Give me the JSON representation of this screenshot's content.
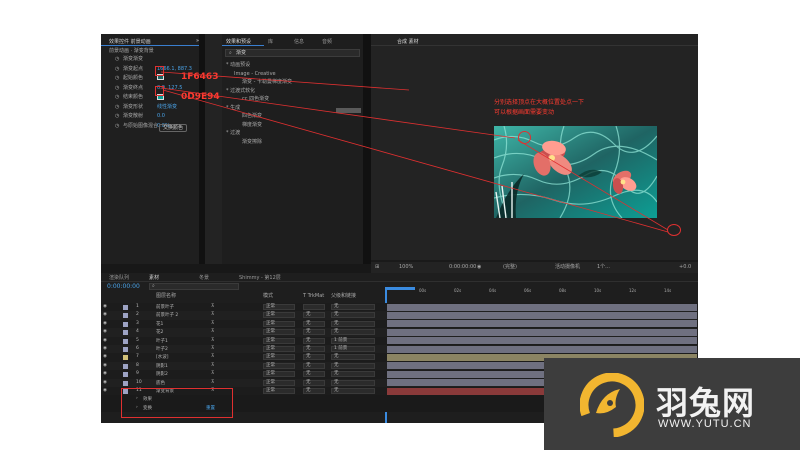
{
  "colors": {
    "accent": "#4aa3e8",
    "annotation": "#ff3b30",
    "swatch1": "#1F6463",
    "swatch2": "#0D9E94",
    "logo_bg": "#3d3d3d",
    "logo_yellow": "#f2b630"
  },
  "effect_panel": {
    "header_tab": "效果控件 前景动画",
    "header_sub": "前景动画 · 渐变背景",
    "rows": [
      {
        "label": "渐变渐变",
        "value": ""
      },
      {
        "label": "渐变起点",
        "value": "1666.1, 887.3"
      },
      {
        "label": "起始颜色",
        "value": ""
      },
      {
        "label": "渐变终点",
        "value": "0.0, 127.5"
      },
      {
        "label": "结束颜色",
        "value": ""
      },
      {
        "label": "渐变形状",
        "value": "线性渐变"
      },
      {
        "label": "渐变散射",
        "value": "0.0"
      },
      {
        "label": "与原始图像混合",
        "value": "0.0%"
      }
    ],
    "reset_button": "交换颜色"
  },
  "effects_presets": {
    "tab_label": "效果和预设",
    "other_tabs": [
      "库",
      "信息",
      "音频"
    ],
    "search_placeholder": "渐变",
    "tree": [
      "* 动画预设",
      "Image - Creative",
      "渐变 - 卡勒曼梯度渐变",
      "* 过渡式软化",
      "cc 四色渐变",
      "* 生成",
      "四色渐变",
      "梯度渐变",
      "* 过渡",
      "渐变擦除"
    ]
  },
  "composition": {
    "tab_label": "合成 素材",
    "zoom": "100%",
    "timecode": "0:00:00:00",
    "resolution": "(完整)",
    "camera": "活动摄像机",
    "views": "1个...",
    "exposure": "+0.0"
  },
  "annotations": {
    "color1": "1F6463",
    "color2": "0D9E94",
    "note_line1": "分别选择顶点在大概位置处点一下",
    "note_line2": "可以根据画面需要变动"
  },
  "timeline": {
    "tabs": [
      "渲染队列",
      "素材",
      "冬景",
      "Shimmy - 第12层"
    ],
    "timecode": "0:00:00:00",
    "search_placeholder": "",
    "columns": [
      "图层名称",
      "模式",
      "T TrkMat",
      "父级和链接"
    ],
    "ruler_marks": [
      "00s",
      "02s",
      "04s",
      "06s",
      "08s",
      "10s",
      "12s",
      "14s",
      "16s",
      "18s",
      "20s"
    ],
    "layers": [
      {
        "num": "1",
        "name": "前景叶子",
        "mode": "正常",
        "trk": "",
        "parent": "无"
      },
      {
        "num": "2",
        "name": "前景叶子 2",
        "mode": "正常",
        "trk": "无",
        "parent": "无"
      },
      {
        "num": "3",
        "name": "花1",
        "mode": "正常",
        "trk": "无",
        "parent": "无"
      },
      {
        "num": "4",
        "name": "花2",
        "mode": "正常",
        "trk": "无",
        "parent": "无"
      },
      {
        "num": "5",
        "name": "叶子1",
        "mode": "正常",
        "trk": "无",
        "parent": "1 前景"
      },
      {
        "num": "6",
        "name": "叶子2",
        "mode": "正常",
        "trk": "无",
        "parent": "1 前景"
      },
      {
        "num": "7",
        "name": "[水波]",
        "mode": "正常",
        "trk": "无",
        "parent": "无"
      },
      {
        "num": "8",
        "name": "阴影1",
        "mode": "正常",
        "trk": "无",
        "parent": "无"
      },
      {
        "num": "9",
        "name": "阴影2",
        "mode": "正常",
        "trk": "无",
        "parent": "无"
      },
      {
        "num": "10",
        "name": "底色",
        "mode": "正常",
        "trk": "无",
        "parent": "无"
      },
      {
        "num": "11",
        "name": "渐变背景",
        "mode": "正常",
        "trk": "无",
        "parent": "无"
      }
    ],
    "sub_rows": [
      {
        "label": "效果",
        "value": ""
      },
      {
        "label": "变换",
        "value": "重置"
      }
    ]
  },
  "logo": {
    "name": "羽兔网",
    "url": "WWW.YUTU.CN"
  }
}
